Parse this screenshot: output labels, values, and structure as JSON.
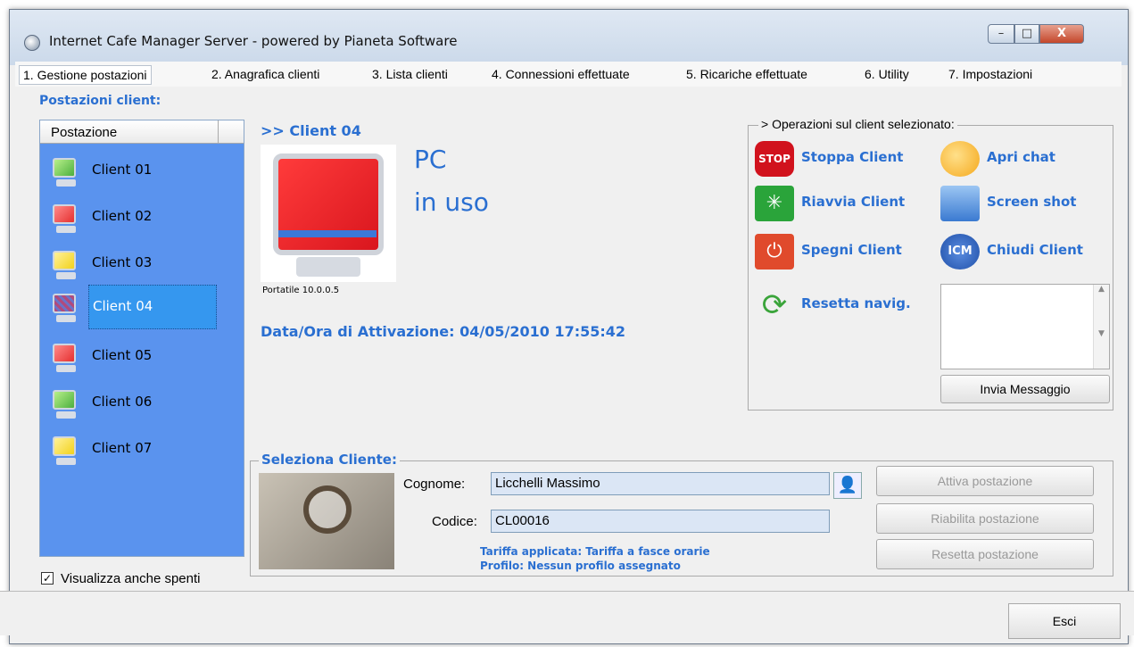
{
  "window": {
    "title": "Internet Cafe Manager Server - powered by Pianeta Software",
    "min": "–",
    "max": "□",
    "close": "X"
  },
  "menu": [
    {
      "label": "1. Gestione postazioni"
    },
    {
      "label": "2. Anagrafica clienti"
    },
    {
      "label": "3. Lista clienti"
    },
    {
      "label": "4. Connessioni effettuate"
    },
    {
      "label": "5. Ricariche effettuate"
    },
    {
      "label": "6. Utility"
    },
    {
      "label": "7. Impostazioni"
    }
  ],
  "clients_panel": {
    "title": "Postazioni client:",
    "column": "Postazione",
    "items": [
      {
        "label": "Client 01",
        "status_color": "#4caf3e"
      },
      {
        "label": "Client 02",
        "status_color": "#e53030"
      },
      {
        "label": "Client 03",
        "status_color": "#f2d21c"
      },
      {
        "label": "Client 04",
        "status_color": "#b14a7c"
      },
      {
        "label": "Client 05",
        "status_color": "#e53030"
      },
      {
        "label": "Client 06",
        "status_color": "#4caf3e"
      },
      {
        "label": "Client 07",
        "status_color": "#f2d21c"
      }
    ],
    "show_off_label": "Visualizza anche spenti",
    "show_off_checked": "✓"
  },
  "selected": {
    "name": ">> Client 04",
    "pc_caption": "Portatile 10.0.0.5",
    "state_line1": "PC",
    "state_line2": "in uso",
    "activation": "Data/Ora di Attivazione: 04/05/2010 17:55:42"
  },
  "operations": {
    "title": "> Operazioni sul client selezionato:",
    "items": [
      {
        "label": "Stoppa Client",
        "icon": "stop-icon",
        "color": "#d1121d"
      },
      {
        "label": "Apri chat",
        "icon": "chat-icon",
        "color": "#f5a81c"
      },
      {
        "label": "Riavvia Client",
        "icon": "restart-icon",
        "color": "#2aa43a"
      },
      {
        "label": "Screen shot",
        "icon": "camera-icon",
        "color": "#3a7ad1"
      },
      {
        "label": "Spegni Client",
        "icon": "power-icon",
        "color": "#e04a2c"
      },
      {
        "label": "Chiudi Client",
        "icon": "close-app-icon",
        "color": "#1f4fa8"
      },
      {
        "label": "Resetta navig.",
        "icon": "refresh-icon",
        "color": "#3aa43a"
      }
    ],
    "send_message": "Invia Messaggio"
  },
  "customer": {
    "title": "Seleziona Cliente:",
    "surname_label": "Cognome:",
    "surname_value": "Licchelli Massimo",
    "code_label": "Codice:",
    "code_value": "CL00016",
    "tariff": "Tariffa applicata: Tariffa a fasce orarie",
    "profile": "Profilo: Nessun profilo assegnato",
    "btn_activate": "Attiva postazione",
    "btn_reenable": "Riabilita postazione",
    "btn_reset": "Resetta postazione"
  },
  "footer": {
    "exit": "Esci"
  }
}
